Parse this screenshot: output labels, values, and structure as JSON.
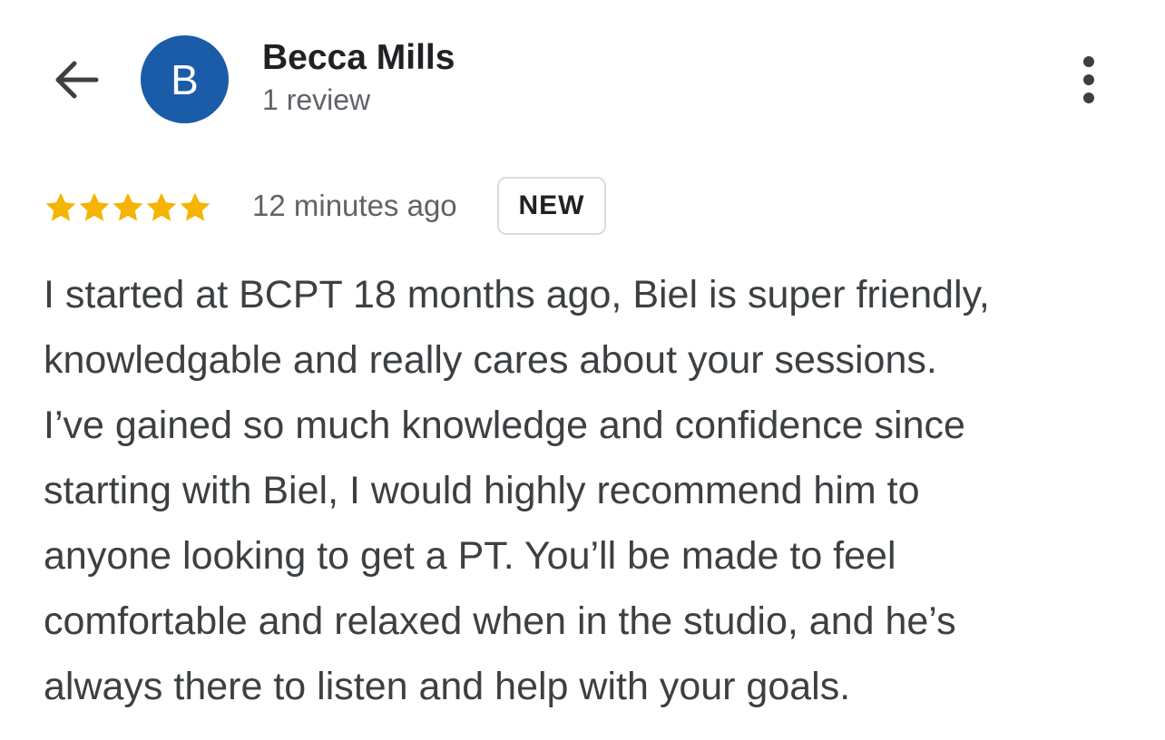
{
  "header": {
    "back_icon": "arrow-left-icon",
    "avatar_letter": "B",
    "avatar_color": "#1a5ca8",
    "user_name": "Becca Mills",
    "review_count": "1 review",
    "more_icon": "more-vert-icon"
  },
  "review": {
    "rating": 5,
    "max_rating": 5,
    "star_color": "#f4b400",
    "time": "12 minutes ago",
    "badge": "NEW",
    "lines": [
      "I started at BCPT 18 months ago, Biel is super friendly,",
      "knowledgable and really cares about your sessions.",
      "I’ve gained so much knowledge and confidence since",
      "starting with Biel, I would highly recommend him to",
      "anyone looking to get a PT. You’ll be made to feel",
      "comfortable and relaxed when in the studio, and he’s",
      "always there to listen and help with your goals."
    ]
  }
}
